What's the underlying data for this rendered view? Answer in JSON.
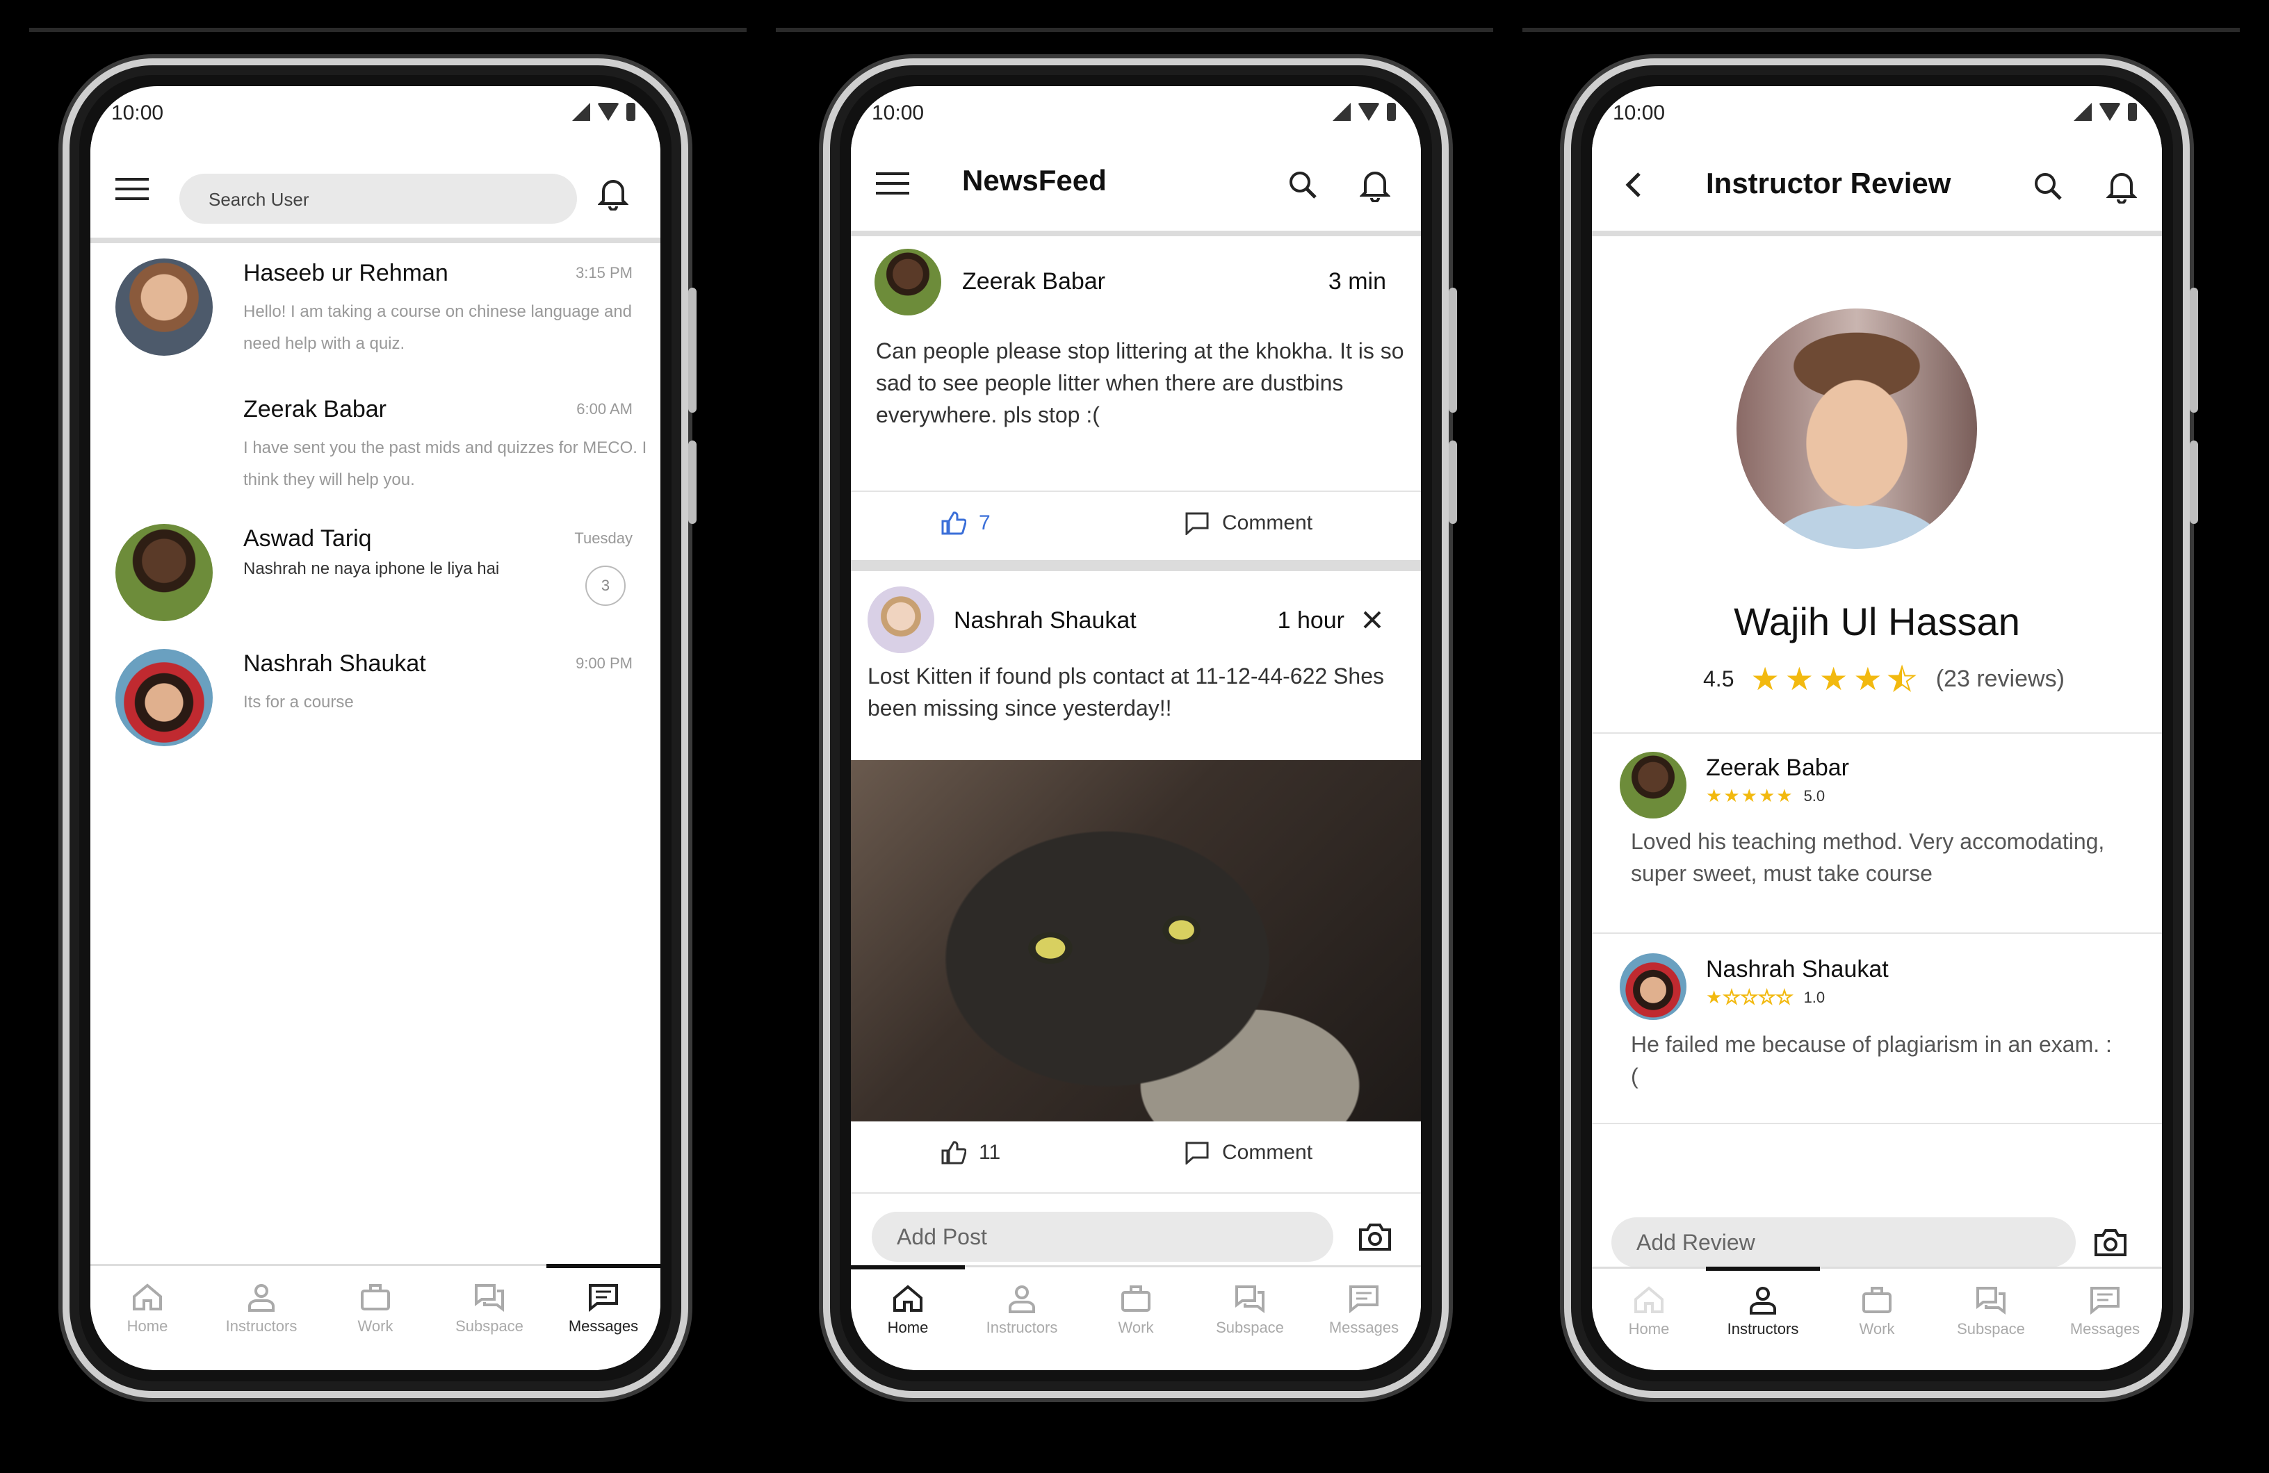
{
  "status_time": "10:00",
  "phones": {
    "messages": {
      "search_placeholder": "Search User",
      "chats": [
        {
          "name": "Haseeb ur Rehman",
          "time": "3:15 PM",
          "message": "Hello! I am taking a course on chinese language and need help with a quiz."
        },
        {
          "name": "Zeerak Babar",
          "time": "6:00 AM",
          "message": "I have sent you the past mids and quizzes for MECO. I think they will help you."
        },
        {
          "name": "Aswad Tariq",
          "time": "Tuesday",
          "message": "Nashrah ne naya iphone le liya hai",
          "unread": "3"
        },
        {
          "name": "Nashrah Shaukat",
          "time": "9:00 PM",
          "message": "Its for a course"
        }
      ]
    },
    "newsfeed": {
      "title": "NewsFeed",
      "posts": [
        {
          "author": "Zeerak Babar",
          "time": "3 min",
          "text": "Can people please stop littering at the khokha. It is so sad to see people litter when there are dustbins everywhere. pls stop :(",
          "likes": "7",
          "comment_label": "Comment"
        },
        {
          "author": "Nashrah Shaukat",
          "time": "1 hour",
          "text": "Lost Kitten if found pls contact at 11-12-44-622 Shes been missing since yesterday!!",
          "likes": "11",
          "comment_label": "Comment"
        }
      ],
      "add_post_placeholder": "Add Post"
    },
    "review": {
      "title": "Instructor Review",
      "instructor_name": "Wajih Ul Hassan",
      "rating": "4.5",
      "reviews_count": "(23 reviews)",
      "reviews": [
        {
          "name": "Zeerak Babar",
          "score": "5.0",
          "stars": 5,
          "text": "Loved his teaching method. Very accomodating, super sweet, must take course"
        },
        {
          "name": "Nashrah Shaukat",
          "score": "1.0",
          "stars": 1,
          "text": "He failed me because of plagiarism in an exam. :("
        }
      ],
      "add_review_placeholder": "Add Review"
    }
  },
  "nav": {
    "home": "Home",
    "instructors": "Instructors",
    "work": "Work",
    "subspace": "Subspace",
    "messages": "Messages"
  },
  "colors": {
    "like_blue": "#3b6fd8",
    "star_yellow": "#f2b90f"
  }
}
